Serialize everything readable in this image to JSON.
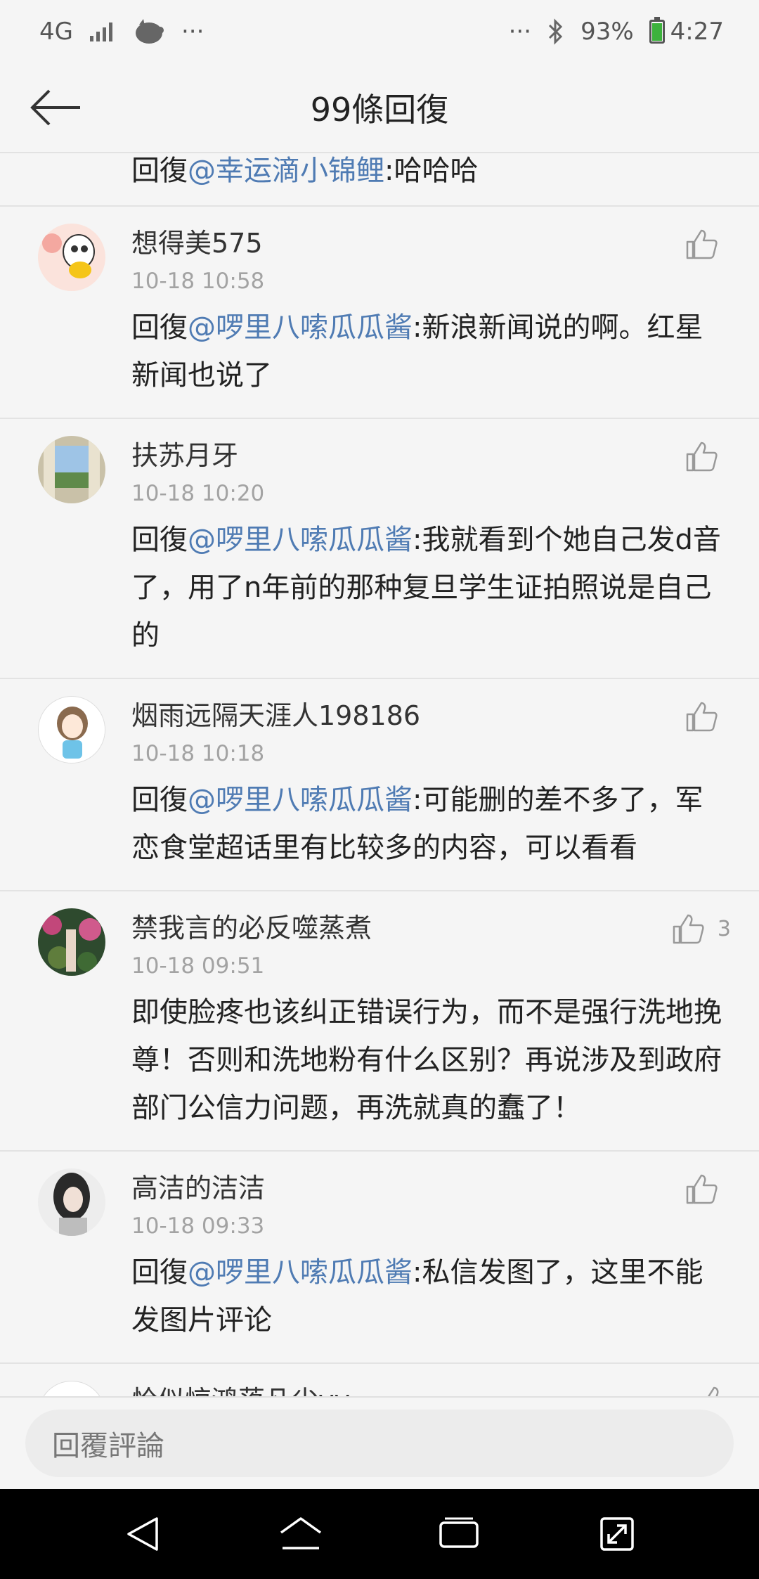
{
  "status": {
    "network": "4G",
    "more_left": "···",
    "more_right": "···",
    "battery": "93%",
    "time": "4:27"
  },
  "header": {
    "title": "99條回復"
  },
  "top_partial": {
    "prefix": "回復",
    "mention": "@幸运滴小锦鲤",
    "text": ":哈哈哈"
  },
  "comments": [
    {
      "user": "想得美575",
      "time": "10-18 10:58",
      "prefix": "回復",
      "mention": "@啰里八嗦瓜瓜酱",
      "text": ":新浪新闻说的啊。红星新闻也说了",
      "likes": ""
    },
    {
      "user": "扶苏月牙",
      "time": "10-18 10:20",
      "prefix": "回復",
      "mention": "@啰里八嗦瓜瓜酱",
      "text": ":我就看到个她自己发d音了，用了n年前的那种复旦学生证拍照说是自己的",
      "likes": ""
    },
    {
      "user": "烟雨远隔天涯人198186",
      "time": "10-18 10:18",
      "prefix": "回復",
      "mention": "@啰里八嗦瓜瓜酱",
      "text": ":可能删的差不多了，军恋食堂超话里有比较多的内容，可以看看",
      "likes": ""
    },
    {
      "user": "禁我言的必反噬蒸煮",
      "time": "10-18 09:51",
      "prefix": "",
      "mention": "",
      "text": "即使脸疼也该纠正错误行为，而不是强行洗地挽尊！否则和洗地粉有什么区别？再说涉及到政府部门公信力问题，再洗就真的蠢了！",
      "likes": "3"
    },
    {
      "user": "高洁的洁洁",
      "time": "10-18 09:33",
      "prefix": "回復",
      "mention": "@啰里八嗦瓜瓜酱",
      "text": ":私信发图了，这里不能发图片评论",
      "likes": ""
    }
  ],
  "partial_bottom": {
    "user": "恰似惊鸿落凡尘yy"
  },
  "comment_box": {
    "placeholder": "回覆評論"
  },
  "colors": {
    "mention": "#4f7bb3",
    "background": "#f5f5f5",
    "time_gray": "#a3a3a3"
  }
}
